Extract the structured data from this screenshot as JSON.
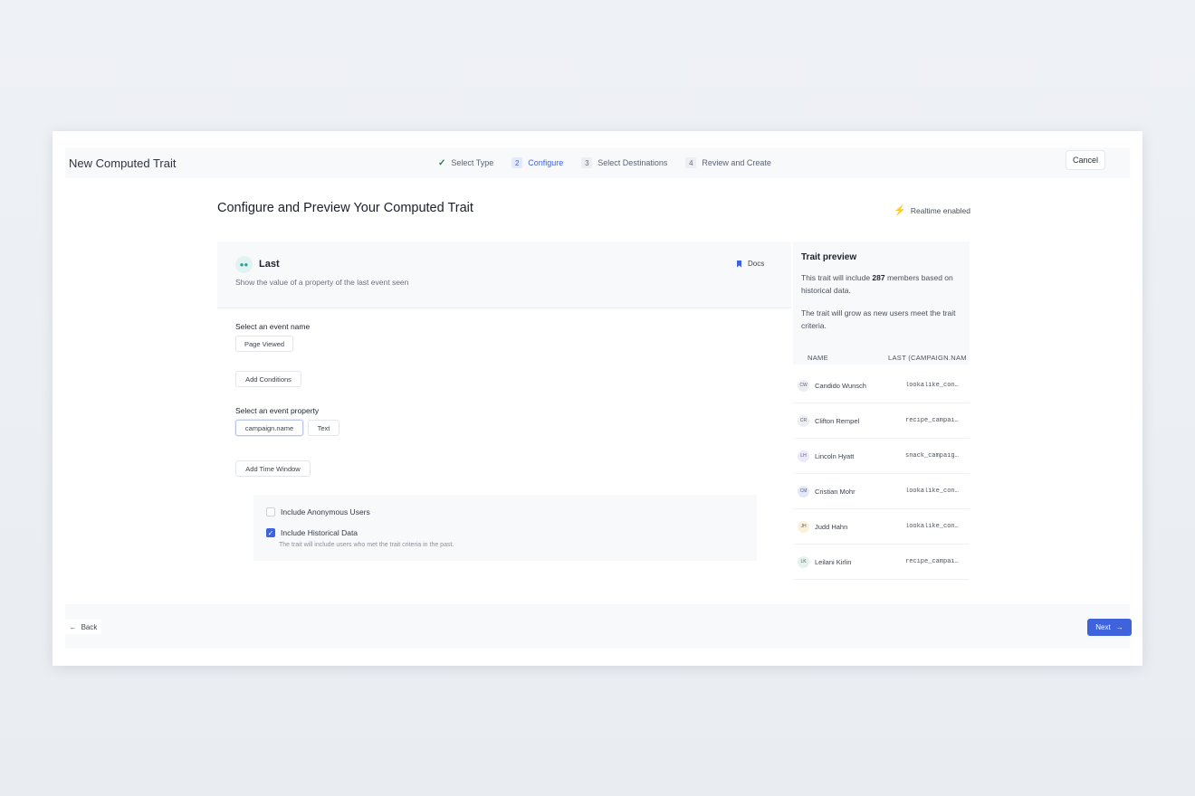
{
  "header": {
    "app_title": "New Computed Trait",
    "steps": [
      {
        "num": "",
        "label": "Select Type"
      },
      {
        "num": "2",
        "label": "Configure"
      },
      {
        "num": "3",
        "label": "Select Destinations"
      },
      {
        "num": "4",
        "label": "Review and Create"
      }
    ],
    "active_step": 1,
    "cancel_label": "Cancel"
  },
  "page": {
    "title": "Configure and Preview Your Computed Trait",
    "realtime_label": "Realtime enabled"
  },
  "card": {
    "type_title": "Last",
    "type_icon": "last-event-icon",
    "type_description": "Show the value of a property of the last event seen",
    "docs_label": "Docs",
    "event_name_label": "Select an event name",
    "event_name_value": "Page Viewed",
    "add_conditions_label": "Add Conditions",
    "event_property_label": "Select an event property",
    "event_property_value": "campaign.name",
    "property_type": "Text",
    "add_time_window_label": "Add Time Window",
    "include_anonymous_label": "Include Anonymous Users",
    "include_anonymous_checked": false,
    "include_historical_label": "Include Historical Data",
    "include_historical_checked": true,
    "include_historical_help": "The trait will include users who met the trait criteria in the past."
  },
  "preview": {
    "title": "Trait preview",
    "text1_prefix": "This trait will include ",
    "member_count": "287",
    "text1_suffix": " members based on historical data.",
    "text2": "The trait will grow as new users meet the trait criteria.",
    "col_name": "NAME",
    "col_value": "LAST (CAMPAIGN.NAM",
    "rows": [
      {
        "initials": "CW",
        "name": "Candido Wunsch",
        "value": "lookalike_con…",
        "avatar_color": "#eceef1"
      },
      {
        "initials": "CR",
        "name": "Clifton Rempel",
        "value": "recipe_campai…",
        "avatar_color": "#eceef1"
      },
      {
        "initials": "LH",
        "name": "Lincoln Hyatt",
        "value": "snack_campaig…",
        "avatar_color": "#ece9fb"
      },
      {
        "initials": "CM",
        "name": "Cristian Mohr",
        "value": "lookalike_con…",
        "avatar_color": "#e1e9fb"
      },
      {
        "initials": "JH",
        "name": "Judd Hahn",
        "value": "lookalike_con…",
        "avatar_color": "#fbf0d9"
      },
      {
        "initials": "LK",
        "name": "Leilani Kirlin",
        "value": "recipe_campai…",
        "avatar_color": "#e3f3ec"
      }
    ]
  },
  "footer": {
    "back_label": "Back",
    "next_label": "Next"
  }
}
